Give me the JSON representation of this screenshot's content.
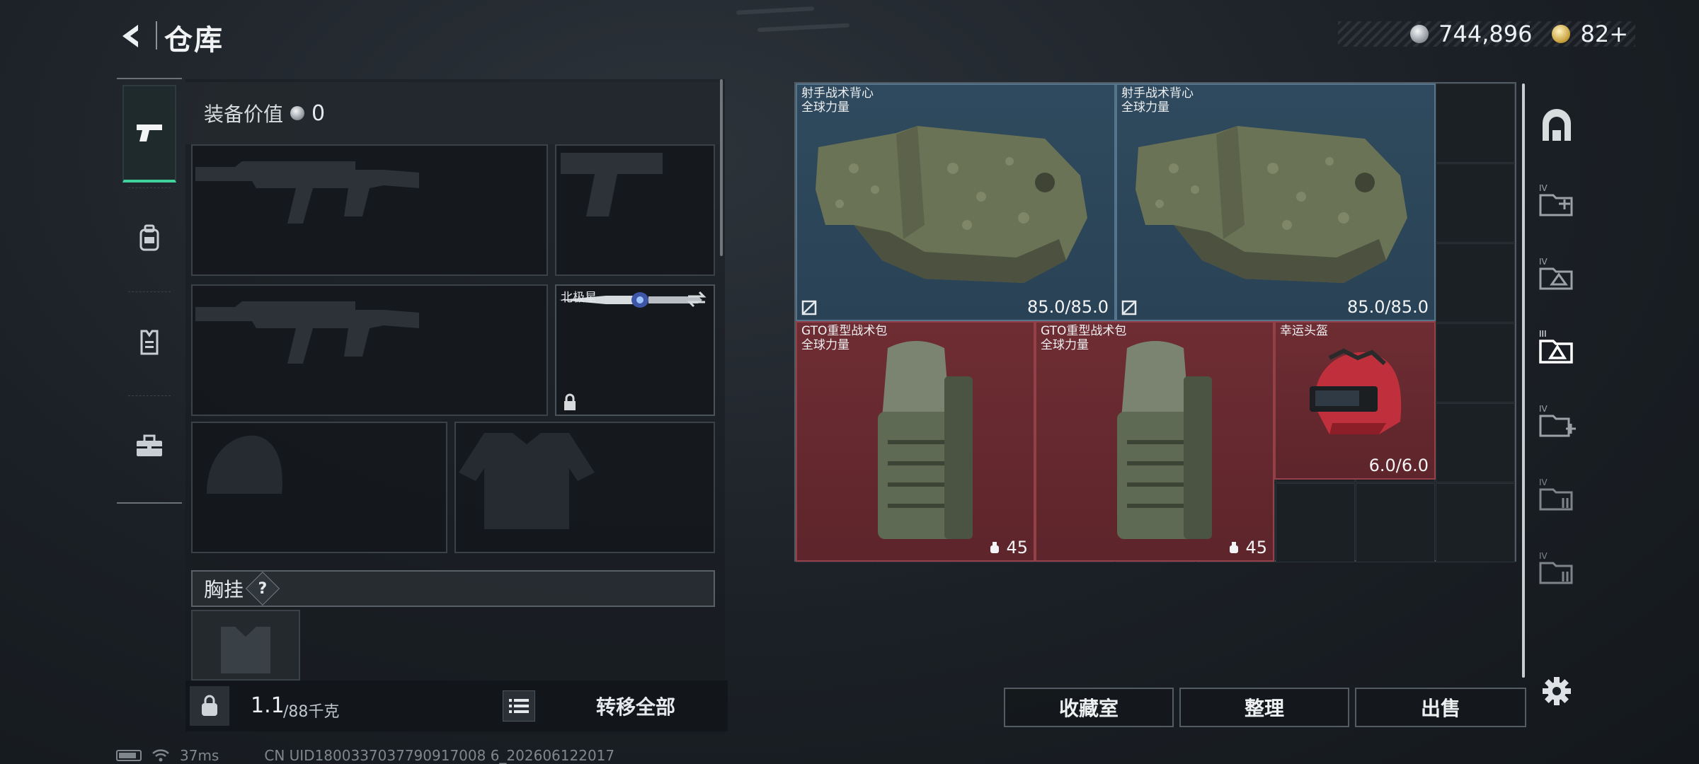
{
  "header": {
    "title": "仓库",
    "silver_amount": "744,896",
    "gold_amount": "82+"
  },
  "left_tabs": [
    "weapon-icon",
    "backpack-icon",
    "vest-icon",
    "toolbox-icon"
  ],
  "loadout": {
    "equip_value_label": "装备价值",
    "equip_value": "0",
    "melee_slot_label": "北极星",
    "chest_rig_label": "胸挂",
    "help_glyph": "?"
  },
  "weight": {
    "current": "1.1",
    "max": "/88千克"
  },
  "transfer_all_label": "转移全部",
  "stash_items": [
    {
      "name": "射手战术背心",
      "tag": "全球力量",
      "count": "85.0/85.0",
      "type": "vest"
    },
    {
      "name": "射手战术背心",
      "tag": "全球力量",
      "count": "85.0/85.0",
      "type": "vest"
    },
    {
      "name": "GTO重型战术包",
      "tag": "全球力量",
      "count": "45",
      "type": "backpack"
    },
    {
      "name": "GTO重型战术包",
      "tag": "全球力量",
      "count": "45",
      "type": "backpack"
    },
    {
      "name": "幸运头盔",
      "tag": "",
      "count": "6.0/6.0",
      "type": "helmet"
    }
  ],
  "actions": {
    "collection": "收藏室",
    "sort": "整理",
    "sell": "出售"
  },
  "status_bar": {
    "ping": "37ms",
    "uid": "CN UID1800337037790917008 6_202606122017"
  },
  "colors": {
    "accent_green": "#3fd29a",
    "item_blue": "#2f4a5e",
    "item_red": "#6e2d33"
  }
}
